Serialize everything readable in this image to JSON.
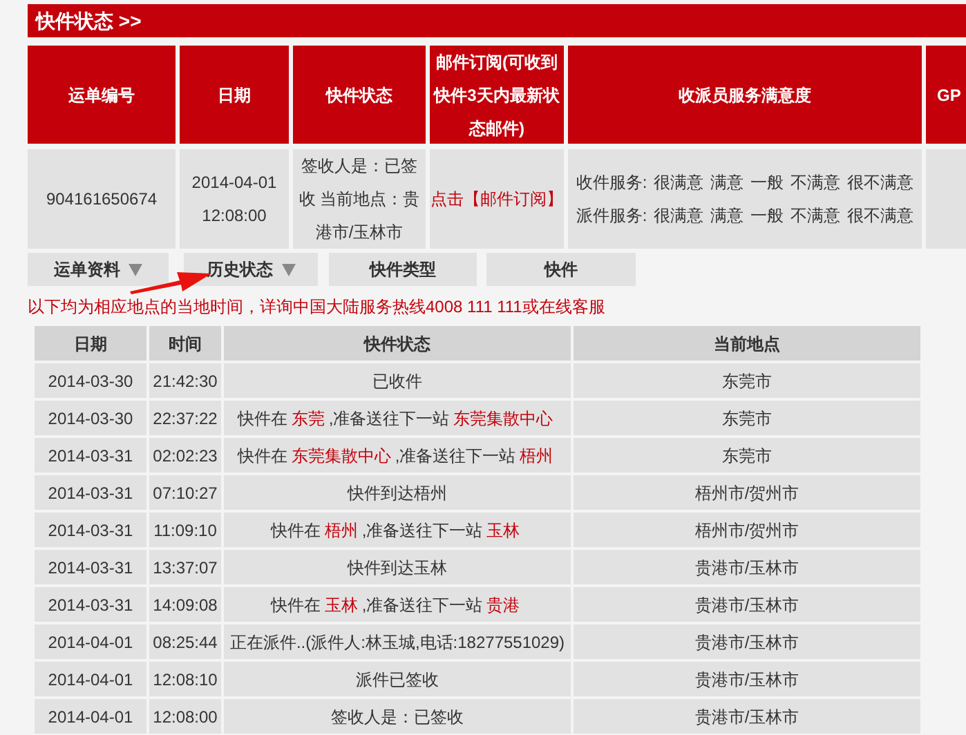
{
  "section_title": "快件状态 >>",
  "summary": {
    "columns": [
      "运单编号",
      "日期",
      "快件状态",
      "邮件订阅(可收到快件3天内最新状态邮件)",
      "收派员服务满意度",
      "GP"
    ],
    "row": {
      "waybill": "904161650674",
      "date": "2014-04-01",
      "time": "12:08:00",
      "status": "签收人是：已签收 当前地点：贵港市/玉林市",
      "subscribe_link": "点击【邮件订阅】",
      "ratings": [
        {
          "label": "收件服务:",
          "options": [
            "很满意",
            "满意",
            "一般",
            "不满意",
            "很不满意"
          ]
        },
        {
          "label": "派件服务:",
          "options": [
            "很满意",
            "满意",
            "一般",
            "不满意",
            "很不满意"
          ]
        }
      ]
    }
  },
  "tabs": [
    {
      "label": "运单资料",
      "dropdown": true
    },
    {
      "label": "历史状态",
      "dropdown": true
    },
    {
      "label": "快件类型",
      "dropdown": false
    },
    {
      "label": "快件",
      "dropdown": false
    }
  ],
  "notice": "以下均为相应地点的当地时间，详询中国大陆服务热线4008 111 111或在线客服",
  "history": {
    "columns": [
      "日期",
      "时间",
      "快件状态",
      "当前地点"
    ],
    "rows": [
      {
        "date": "2014-03-30",
        "time": "21:42:30",
        "status": [
          {
            "text": "已收件",
            "highlight": false
          }
        ],
        "location": "东莞市"
      },
      {
        "date": "2014-03-30",
        "time": "22:37:22",
        "status": [
          {
            "text": "快件在",
            "highlight": false
          },
          {
            "text": "东莞",
            "highlight": true
          },
          {
            "text": ",准备送往下一站",
            "highlight": false
          },
          {
            "text": "东莞集散中心",
            "highlight": true
          }
        ],
        "location": "东莞市"
      },
      {
        "date": "2014-03-31",
        "time": "02:02:23",
        "status": [
          {
            "text": "快件在",
            "highlight": false
          },
          {
            "text": "东莞集散中心",
            "highlight": true
          },
          {
            "text": ",准备送往下一站",
            "highlight": false
          },
          {
            "text": "梧州",
            "highlight": true
          }
        ],
        "location": "东莞市"
      },
      {
        "date": "2014-03-31",
        "time": "07:10:27",
        "status": [
          {
            "text": "快件到达梧州",
            "highlight": false
          }
        ],
        "location": "梧州市/贺州市"
      },
      {
        "date": "2014-03-31",
        "time": "11:09:10",
        "status": [
          {
            "text": "快件在",
            "highlight": false
          },
          {
            "text": "梧州",
            "highlight": true
          },
          {
            "text": ",准备送往下一站",
            "highlight": false
          },
          {
            "text": "玉林",
            "highlight": true
          }
        ],
        "location": "梧州市/贺州市"
      },
      {
        "date": "2014-03-31",
        "time": "13:37:07",
        "status": [
          {
            "text": "快件到达玉林",
            "highlight": false
          }
        ],
        "location": "贵港市/玉林市"
      },
      {
        "date": "2014-03-31",
        "time": "14:09:08",
        "status": [
          {
            "text": "快件在",
            "highlight": false
          },
          {
            "text": "玉林",
            "highlight": true
          },
          {
            "text": ",准备送往下一站",
            "highlight": false
          },
          {
            "text": "贵港",
            "highlight": true
          }
        ],
        "location": "贵港市/玉林市"
      },
      {
        "date": "2014-04-01",
        "time": "08:25:44",
        "status": [
          {
            "text": "正在派件..(派件人:林玉城,电话:18277551029)",
            "highlight": false
          }
        ],
        "location": "贵港市/玉林市"
      },
      {
        "date": "2014-04-01",
        "time": "12:08:10",
        "status": [
          {
            "text": "派件已签收",
            "highlight": false
          }
        ],
        "location": "贵港市/玉林市"
      },
      {
        "date": "2014-04-01",
        "time": "12:08:00",
        "status": [
          {
            "text": "签收人是：已签收",
            "highlight": false
          }
        ],
        "location": "贵港市/玉林市"
      }
    ]
  }
}
